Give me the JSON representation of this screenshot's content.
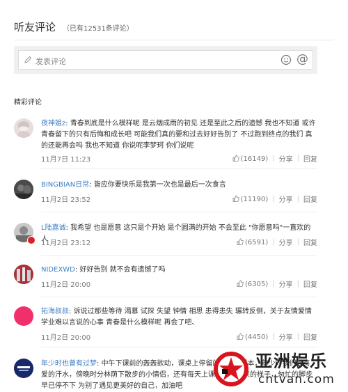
{
  "header": {
    "title": "听友评论",
    "count": "（已有12531条评论）"
  },
  "composer": {
    "placeholder": "发表评论"
  },
  "section": {
    "title": "精彩评论"
  },
  "comments": [
    {
      "user": "夜神姐z",
      "text": "青春到底是什么模样呢 是云烟成雨的初见 还是至此之后的遗憾 我也不知道 或许青春留下的只有后悔和成长吧 可能我们真的要和过去好好告别了 不过跑到终点的我们 真的还能再会吗 我也不知道 你说呢李梦珂 你们说呢",
      "time": "11月7日 11:23",
      "likes": "(16149)",
      "share": "分享",
      "reply": "回复"
    },
    {
      "user": "BINGBIAN日常",
      "text": "皆应你要快乐是我第一次也是最后一次食言",
      "time": "11月2日 23:52",
      "likes": "(11190)",
      "share": "分享",
      "reply": "回复"
    },
    {
      "user": "L陆嘉诚",
      "text": "我希望 也是愿意 这只是个开始 是个圆满的开始 不会至此 \"你愿意吗\"一直欢的人",
      "time": "11月2日 23:12",
      "likes": "(6591)",
      "share": "分享",
      "reply": "回复"
    },
    {
      "user": "NIDEXWD",
      "text": "好好告别 就不会有遗憾了吗",
      "time": "11月2日 20:00",
      "likes": "(6305)",
      "share": "分享",
      "reply": "回复"
    },
    {
      "user": "拓海叔叔",
      "text": "诉说过那些等待 渴慕 试探 失望 钟情 相思 患得患失 辗转反侧，关于友情爱情学业难以言说的心事 青春是什么模样呢 再会了吧、",
      "time": "11月2日 20:00",
      "likes": "(4450)",
      "share": "分享",
      "reply": "回复"
    },
    {
      "user": "年少时也曾有过梦",
      "text": "中午下课前的轰轰欲动，课桌上停留的我们的课本，年少时我们最喜爱的汗水，傍晚时分林荫下散步的小情侣，还有每天上课时那节早读的样子，匆忙的脚步早已停不下 为别了遇见更美好的自己，加油吧",
      "time": "",
      "likes": "",
      "share": "",
      "reply": ""
    }
  ],
  "watermark": {
    "brand": "亚洲娱乐",
    "url": "cntvan.com"
  }
}
